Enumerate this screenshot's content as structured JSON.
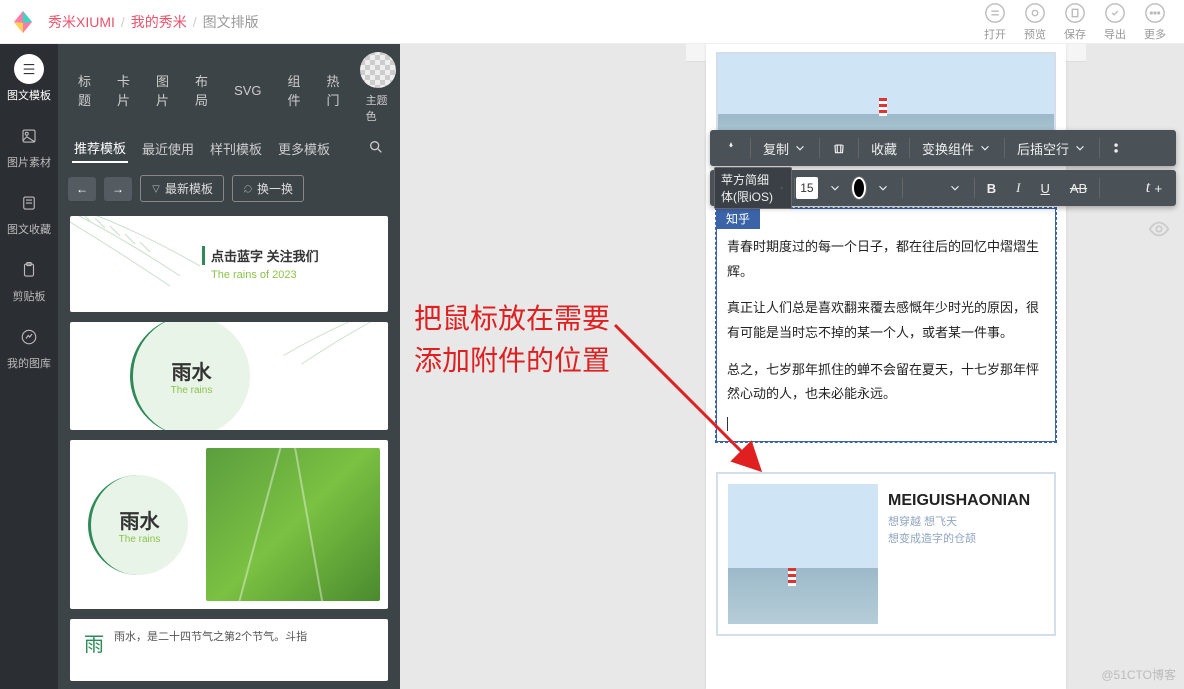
{
  "breadcrumb": {
    "brand": "秀米XIUMI",
    "mine": "我的秀米",
    "current": "图文排版"
  },
  "top_actions": {
    "open": "打开",
    "preview": "预览",
    "save": "保存",
    "export": "导出",
    "more": "更多"
  },
  "rail": {
    "templates": "图文模板",
    "assets": "图片素材",
    "collect": "图文收藏",
    "clipboard": "剪贴板",
    "mylib": "我的图库"
  },
  "tabs1": {
    "title": "标题",
    "card": "卡片",
    "image": "图片",
    "layout": "布局",
    "svg": "SVG",
    "component": "组件",
    "hot": "热门"
  },
  "theme": "主题色",
  "tabs2": {
    "recommend": "推荐模板",
    "recent": "最近使用",
    "sample": "样刊模板",
    "more": "更多模板"
  },
  "toolbar": {
    "latest": "最新模板",
    "shuffle": "换一换"
  },
  "card1": {
    "h": "点击蓝字 关注我们",
    "p": "The rains of 2023"
  },
  "card2": {
    "h": "雨水",
    "p": "The rains"
  },
  "card3": {
    "h": "雨水",
    "p": "The rains"
  },
  "card4": {
    "yu": "雨",
    "txt": "雨水，是二十四节气之第2个节气。斗指"
  },
  "float1": {
    "copy": "复制",
    "collect": "收藏",
    "convert": "变换组件",
    "insert": "后插空行"
  },
  "float2": {
    "font": "苹方简细体(限iOS)",
    "size": "15",
    "b": "B",
    "i": "I",
    "u": "U",
    "ab": "AB"
  },
  "doc": {
    "label": "知乎",
    "p1": "青春时期度过的每一个日子，都在往后的回忆中熠熠生辉。",
    "p2": "真正让人们总是喜欢翻来覆去感慨年少时光的原因，很有可能是当时忘不掉的某一个人，或者某一件事。",
    "p3": "总之，七岁那年抓住的蝉不会留在夏天，十七岁那年怦然心动的人，也未必能永远。",
    "title": "MEIGUISHAONIAN",
    "sub1": "想穿越 想飞天",
    "sub2": "想变成造字的仓颉"
  },
  "instruction": {
    "l1": "把鼠标放在需要",
    "l2": "添加附件的位置"
  },
  "watermark": "@51CTO博客"
}
